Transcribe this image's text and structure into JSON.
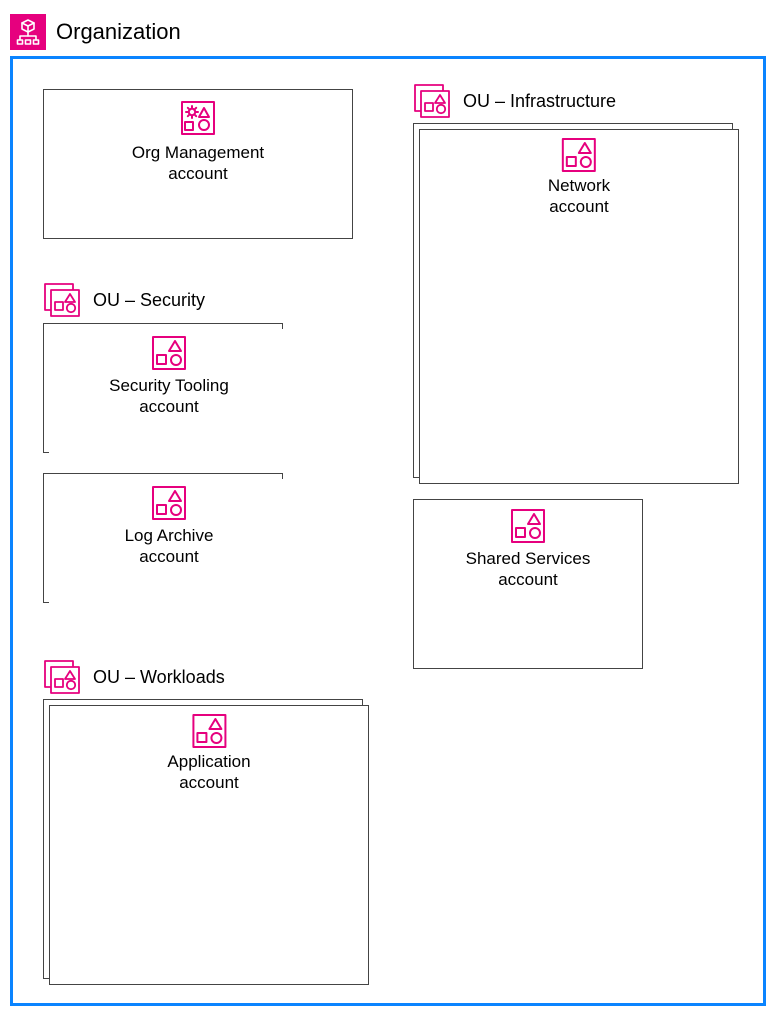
{
  "organization": {
    "title": "Organization"
  },
  "accounts": {
    "org_management": {
      "line1": "Org Management",
      "line2": "account"
    },
    "security_tooling": {
      "line1": "Security Tooling",
      "line2": "account"
    },
    "log_archive": {
      "line1": "Log Archive",
      "line2": "account"
    },
    "network": {
      "line1": "Network",
      "line2": "account"
    },
    "shared_services": {
      "line1": "Shared Services",
      "line2": "account"
    },
    "application": {
      "line1": "Application",
      "line2": "account"
    }
  },
  "ous": {
    "security": {
      "label": "OU – Security"
    },
    "infrastructure": {
      "label": "OU – Infrastructure"
    },
    "workloads": {
      "label": "OU – Workloads"
    }
  },
  "colors": {
    "accent": "#e6007e",
    "frame": "#0a84ff",
    "line": "#444444"
  }
}
